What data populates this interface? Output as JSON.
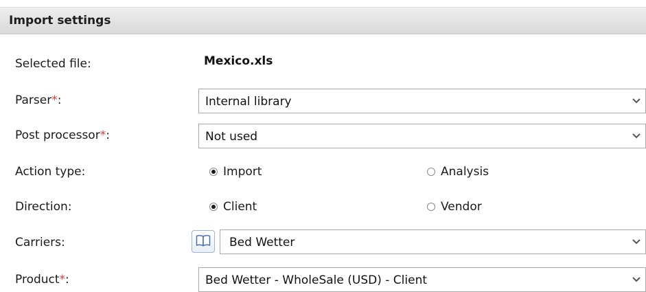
{
  "header": {
    "title": "Import settings"
  },
  "fields": {
    "selected_file": {
      "label": "Selected file:",
      "value": "Mexico.xls"
    },
    "parser": {
      "label": "Parser",
      "required_mark": "*",
      "colon": ":",
      "value": "Internal library"
    },
    "post_processor": {
      "label": "Post processor",
      "required_mark": "*",
      "colon": ":",
      "value": "Not used"
    },
    "action_type": {
      "label": "Action type:",
      "options": [
        {
          "label": "Import",
          "selected": true
        },
        {
          "label": "Analysis",
          "selected": false
        }
      ]
    },
    "direction": {
      "label": "Direction:",
      "options": [
        {
          "label": "Client",
          "selected": true
        },
        {
          "label": "Vendor",
          "selected": false
        }
      ]
    },
    "carriers": {
      "label": "Carriers:",
      "value": "Bed Wetter",
      "picker_icon": "book-icon"
    },
    "product": {
      "label": "Product",
      "required_mark": "*",
      "colon": ":",
      "value": "Bed Wetter - WholeSale (USD) - Client"
    }
  },
  "colors": {
    "required": "#e23b3b",
    "header_bg": "#e0e0e0"
  }
}
